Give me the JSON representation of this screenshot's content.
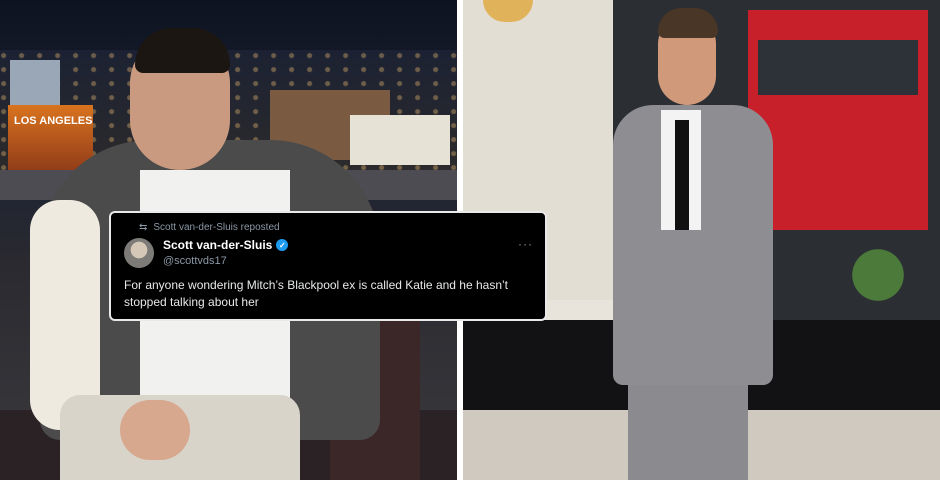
{
  "left_photo": {
    "poster_text": "LOS ANGELES"
  },
  "tweet": {
    "reposted_by": "Scott van-der-Sluis reposted",
    "name": "Scott van-der-Sluis",
    "handle": "@scottvds17",
    "text": "For anyone wondering Mitch’s Blackpool ex is called Katie and he hasn’t stopped talking about her",
    "more_glyph": "···",
    "repost_icon": "repost-icon",
    "verified_icon": "verified-badge-icon",
    "colors": {
      "background": "#000000",
      "text": "#e7e9ea",
      "muted": "#8b98a5",
      "verified": "#1d9bf0"
    }
  }
}
